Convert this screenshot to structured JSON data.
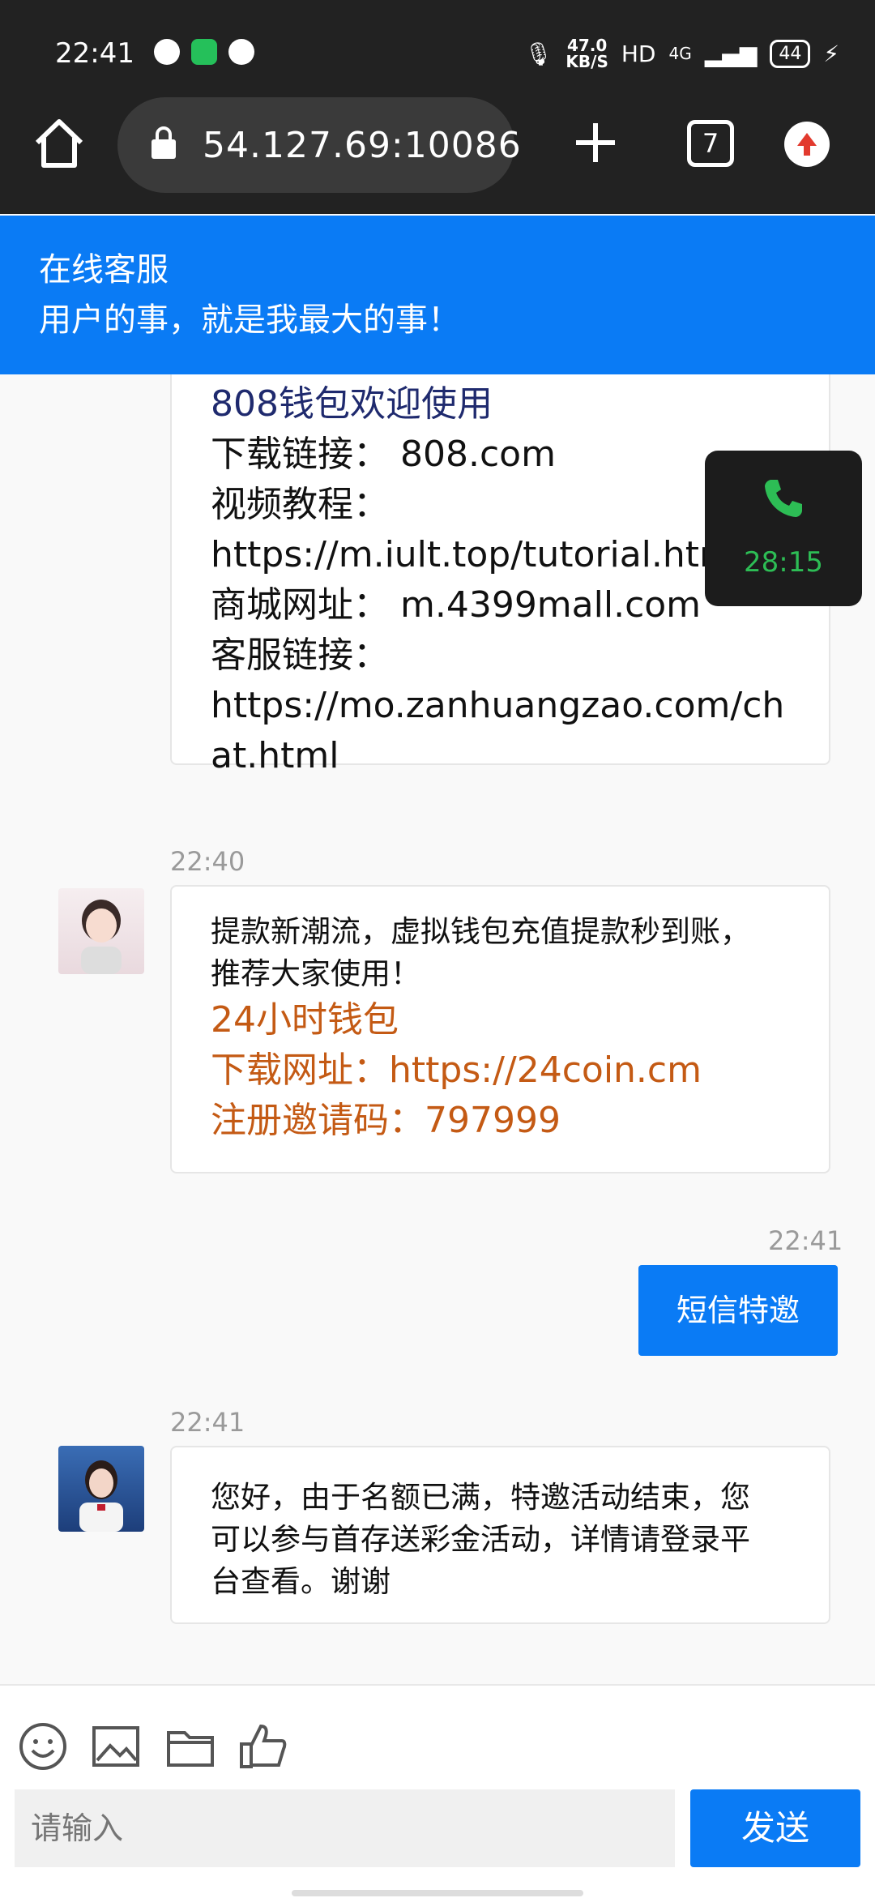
{
  "status": {
    "time": "22:41",
    "speed_value": "47.0",
    "speed_unit": "KB/S",
    "network": "HD",
    "signal": "4G",
    "battery": "44"
  },
  "browser": {
    "url": "54.127.69:10086",
    "tab_count": "7"
  },
  "header": {
    "title": "在线客服",
    "subtitle": "用户的事，就是我最大的事！"
  },
  "call": {
    "duration": "28:15"
  },
  "messages": [
    {
      "lines": [
        "808钱包欢迎使用",
        "下载链接： 808.com",
        "视频教程：",
        "https://m.iult.top/tutorial.htm",
        "商城网址： m.4399mall.com",
        "客服链接：",
        "https://mo.zanhuangzao.com/ch",
        "at.html"
      ]
    },
    {
      "time": "22:40",
      "text_lines": [
        "提款新潮流，虚拟钱包充值提款秒到账，",
        "推荐大家使用！"
      ],
      "highlight_lines": [
        "24小时钱包",
        "下载网址：https://24coin.cm",
        "注册邀请码：797999"
      ]
    },
    {
      "time": "22:41",
      "text": "短信特邀"
    },
    {
      "time": "22:41",
      "text_lines": [
        "您好，由于名额已满，特邀活动结束，您",
        "可以参与首存送彩金活动，详情请登录平",
        "台查看。谢谢"
      ]
    }
  ],
  "composer": {
    "placeholder": "请输入",
    "send_label": "发送"
  },
  "colors": {
    "accent": "#0a7bf5",
    "highlight": "#c45a14",
    "call_green": "#2dbd55"
  }
}
